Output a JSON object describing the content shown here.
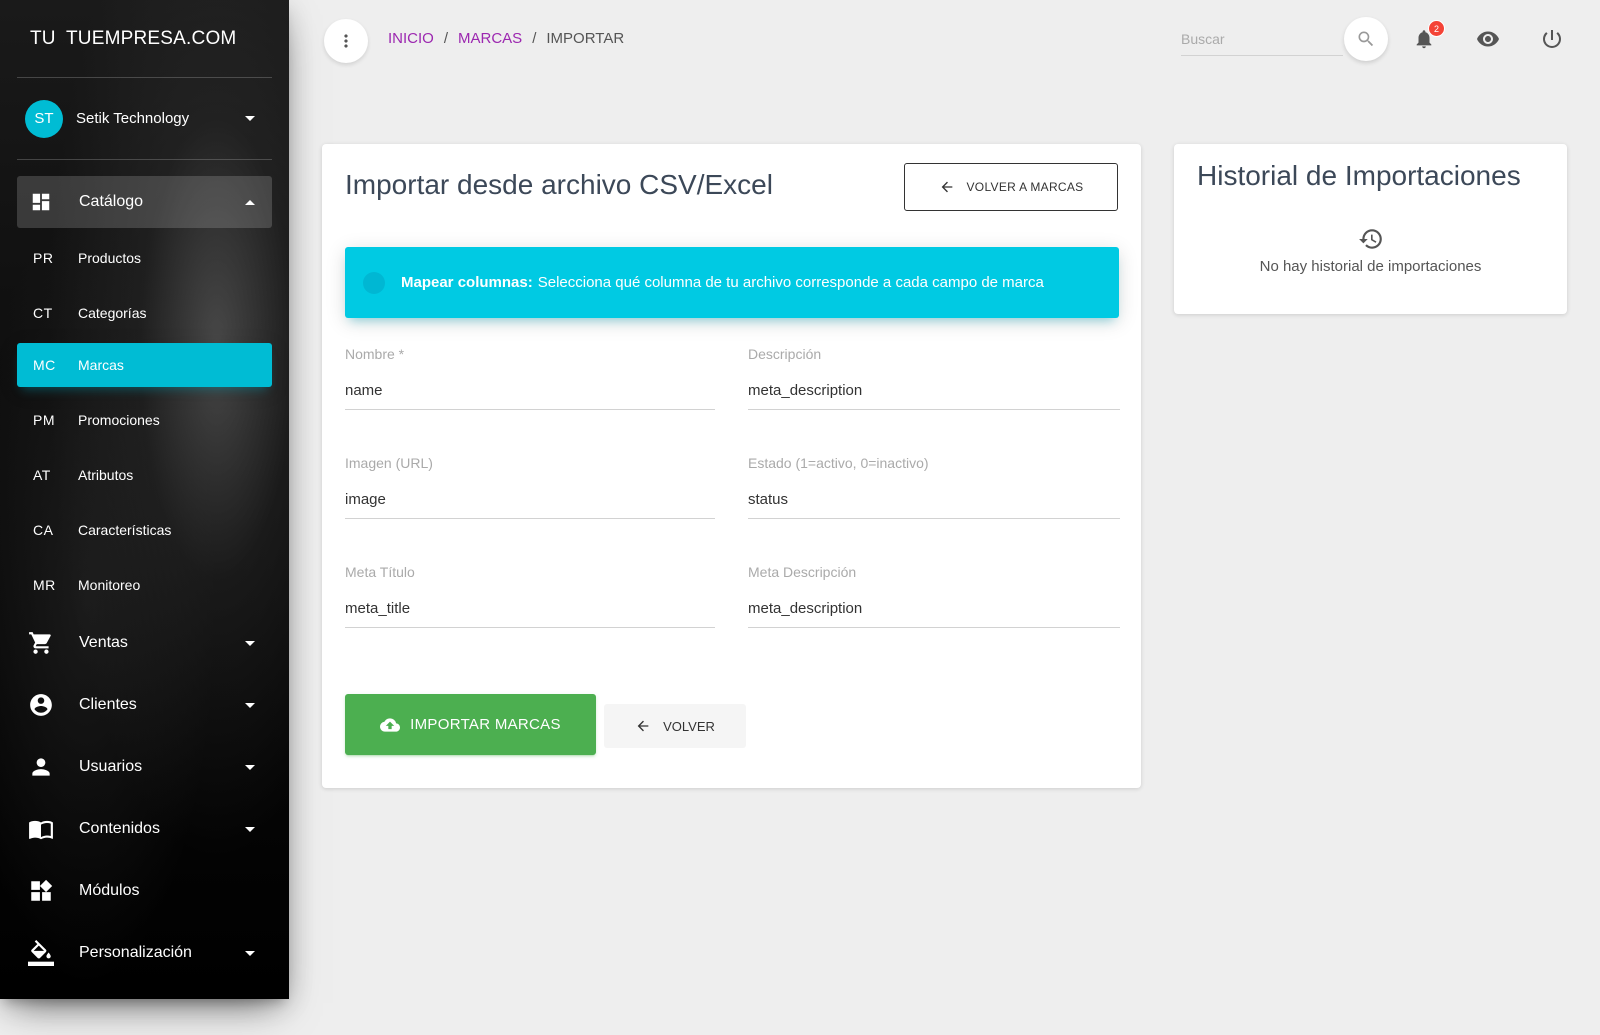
{
  "sidebar": {
    "logo_mini": "TU",
    "logo_full": "TUEMPRESA.COM",
    "user": {
      "initials": "ST",
      "name": "Setik Technology"
    },
    "catalog": {
      "label": "Catálogo",
      "items": [
        {
          "abbr": "PR",
          "label": "Productos"
        },
        {
          "abbr": "CT",
          "label": "Categorías"
        },
        {
          "abbr": "MC",
          "label": "Marcas"
        },
        {
          "abbr": "PM",
          "label": "Promociones"
        },
        {
          "abbr": "AT",
          "label": "Atributos"
        },
        {
          "abbr": "CA",
          "label": "Características"
        },
        {
          "abbr": "MR",
          "label": "Monitoreo"
        }
      ]
    },
    "menu": [
      {
        "label": "Ventas",
        "icon": "cart-icon"
      },
      {
        "label": "Clientes",
        "icon": "account-circle-icon"
      },
      {
        "label": "Usuarios",
        "icon": "person-icon"
      },
      {
        "label": "Contenidos",
        "icon": "book-icon"
      },
      {
        "label": "Módulos",
        "icon": "widgets-icon"
      },
      {
        "label": "Personalización",
        "icon": "paint-bucket-icon"
      }
    ]
  },
  "topbar": {
    "breadcrumb": [
      "INICIO",
      "MARCAS",
      "IMPORTAR"
    ],
    "search_placeholder": "Buscar",
    "notifications_count": "2"
  },
  "import_card": {
    "title": "Importar desde archivo CSV/Excel",
    "back_to_brands_label": "VOLVER A MARCAS",
    "alert": {
      "strong": "Mapear columnas:",
      "text": "Selecciona qué columna de tu archivo corresponde a cada campo de marca"
    },
    "fields": [
      {
        "label": "Nombre *",
        "value": "name"
      },
      {
        "label": "Descripción",
        "value": "meta_description"
      },
      {
        "label": "Imagen (URL)",
        "value": "image"
      },
      {
        "label": "Estado (1=activo, 0=inactivo)",
        "value": "status"
      },
      {
        "label": "Meta Título",
        "value": "meta_title"
      },
      {
        "label": "Meta Descripción",
        "value": "meta_description"
      }
    ],
    "import_button_label": "IMPORTAR MARCAS",
    "back_button_label": "VOLVER"
  },
  "history_card": {
    "title": "Historial de Importaciones",
    "empty_text": "No hay historial de importaciones"
  },
  "colors": {
    "primary": "#00bcd4",
    "breadcrumb_link": "#9c27b0",
    "success": "#4caf50",
    "badge": "#f44336"
  }
}
